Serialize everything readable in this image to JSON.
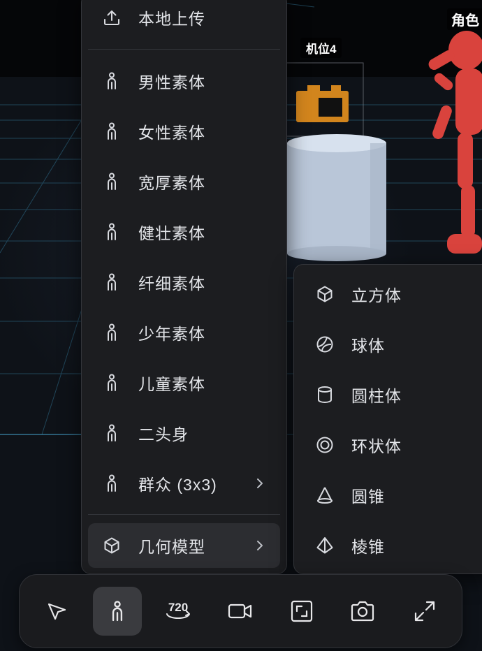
{
  "scene": {
    "camera_label": "机位4",
    "role_label": "角色"
  },
  "menu": {
    "items": [
      {
        "label": "本地上传",
        "icon": "upload-icon"
      },
      {
        "label": "男性素体",
        "icon": "person-icon"
      },
      {
        "label": "女性素体",
        "icon": "person-icon"
      },
      {
        "label": "宽厚素体",
        "icon": "person-icon"
      },
      {
        "label": "健壮素体",
        "icon": "person-icon"
      },
      {
        "label": "纤细素体",
        "icon": "person-icon"
      },
      {
        "label": "少年素体",
        "icon": "person-icon"
      },
      {
        "label": "儿童素体",
        "icon": "person-icon"
      },
      {
        "label": "二头身",
        "icon": "person-icon"
      },
      {
        "label": "群众 (3x3)",
        "icon": "person-icon"
      },
      {
        "label": "几何模型",
        "icon": "cube-icon"
      }
    ]
  },
  "submenu": {
    "items": [
      {
        "label": "立方体",
        "icon": "cube-icon"
      },
      {
        "label": "球体",
        "icon": "sphere-icon"
      },
      {
        "label": "圆柱体",
        "icon": "cylinder-icon"
      },
      {
        "label": "环状体",
        "icon": "torus-icon"
      },
      {
        "label": "圆锥",
        "icon": "cone-icon"
      },
      {
        "label": "棱锥",
        "icon": "pyramid-icon"
      }
    ]
  },
  "toolbar": {
    "buttons": [
      {
        "icon": "pointer-icon"
      },
      {
        "icon": "person-icon",
        "active": true
      },
      {
        "icon": "rotate-720-icon",
        "text": "720"
      },
      {
        "icon": "video-camera-icon"
      },
      {
        "icon": "frame-icon"
      },
      {
        "icon": "camera-icon"
      },
      {
        "icon": "expand-icon"
      }
    ]
  },
  "colors": {
    "accent_object": "#d2851d",
    "character": "#d9433d",
    "cylinder": "#b9c6d8",
    "grid_line": "#3a8fb5"
  }
}
